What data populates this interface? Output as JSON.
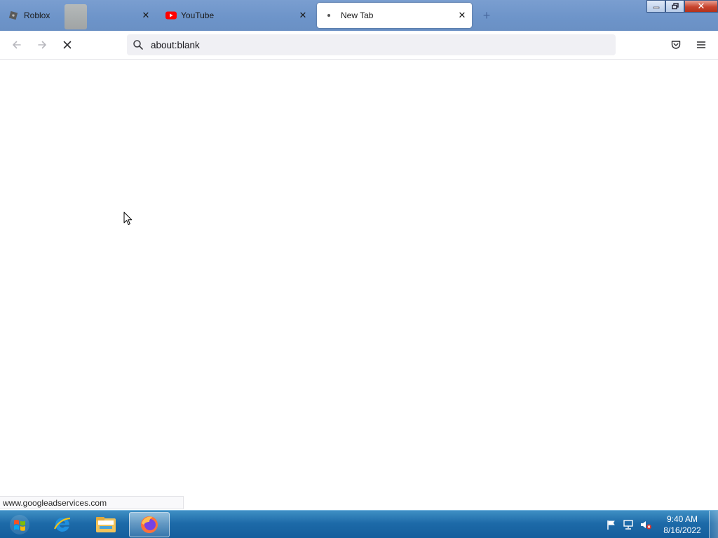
{
  "browser": {
    "tabs": [
      {
        "label": "Roblox",
        "favicon": "roblox-icon",
        "active": false
      },
      {
        "label": "YouTube",
        "favicon": "youtube-icon",
        "active": false
      },
      {
        "label": "New Tab",
        "favicon": "loading-dot-icon",
        "active": true
      }
    ],
    "new_tab_icon": "plus-icon",
    "window_controls": {
      "minimize": "minimize-icon",
      "maximize": "restore-icon",
      "close": "✕"
    },
    "url": "about:blank",
    "status_url": "www.googleadservices.com"
  },
  "taskbar": {
    "apps": [
      "internet-explorer-icon",
      "file-explorer-icon",
      "firefox-icon"
    ],
    "active_app": "firefox-icon",
    "clock_time": "9:40 AM",
    "clock_date": "8/16/2022"
  },
  "colors": {
    "tabstrip": "#6d94c9",
    "taskbar": "#1d6aa8",
    "youtube_red": "#ff0000",
    "close_red": "#c8442e"
  }
}
